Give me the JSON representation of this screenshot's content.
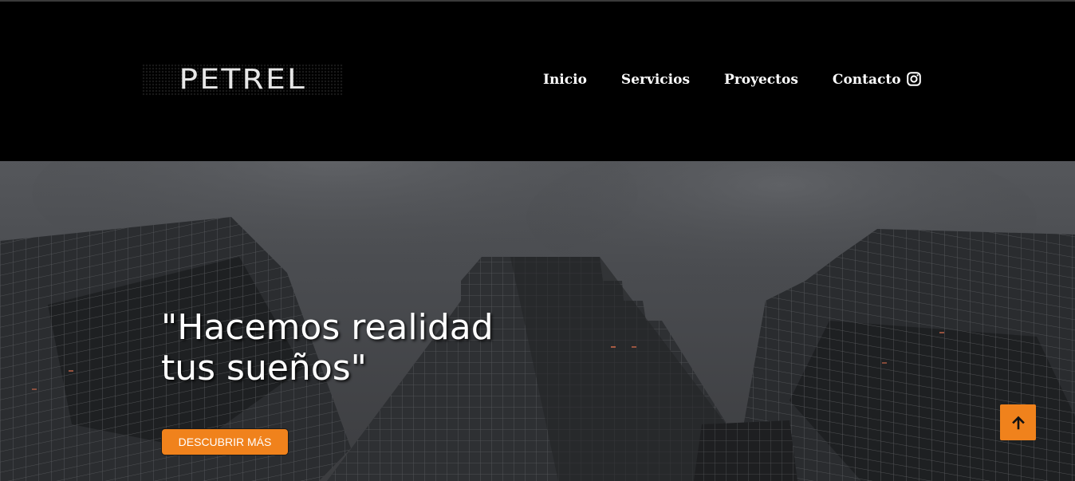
{
  "brand": {
    "logo_text": "PETREL"
  },
  "nav": {
    "items": [
      {
        "label": "Inicio"
      },
      {
        "label": "Servicios"
      },
      {
        "label": "Proyectos"
      },
      {
        "label": "Contacto"
      }
    ],
    "social_icon": "instagram-icon"
  },
  "hero": {
    "title_line1": "\"Hacemos realidad",
    "title_line2": "tus sueños\"",
    "cta_label": "DESCUBRIR MÁS",
    "background": "skyscrapers-photo"
  },
  "scroll_top": {
    "icon": "arrow-up-icon"
  },
  "colors": {
    "accent": "#f0821c",
    "header_bg": "#000000",
    "text": "#ffffff"
  }
}
